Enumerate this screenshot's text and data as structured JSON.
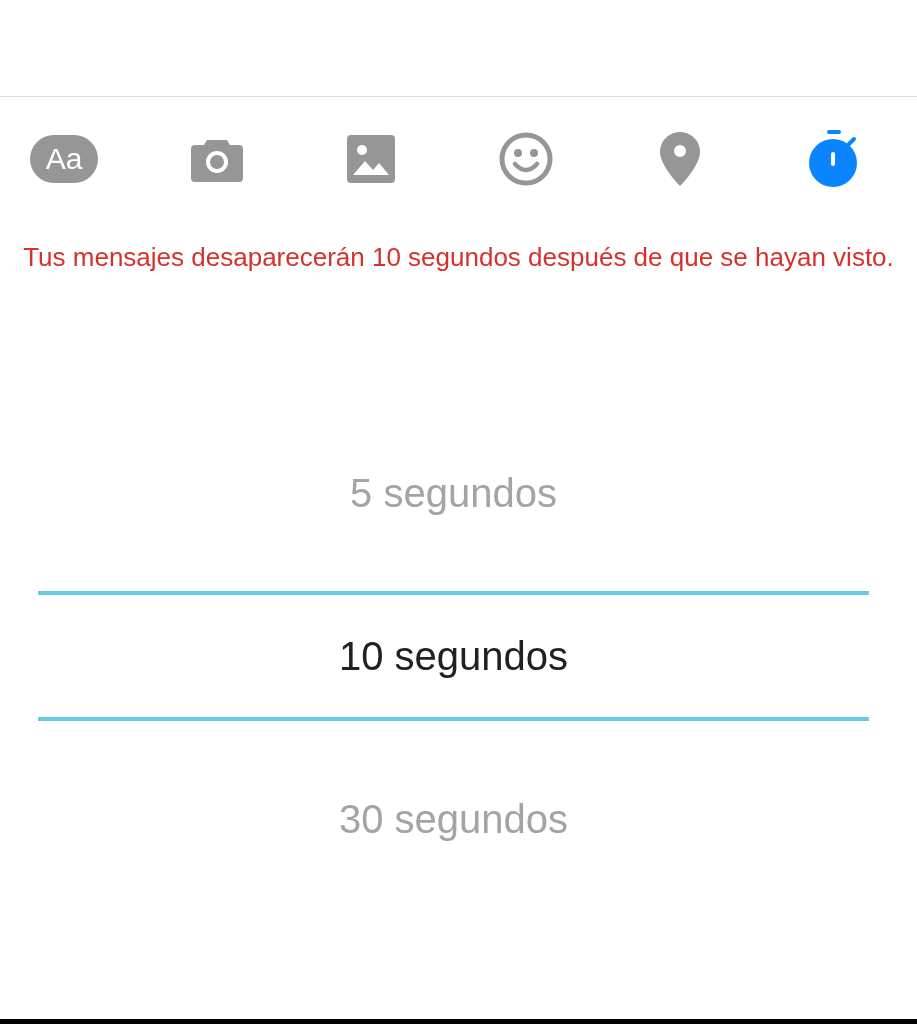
{
  "toolbar": [
    {
      "kind": "text",
      "label": "Aa",
      "selected": false
    },
    {
      "kind": "camera",
      "selected": false
    },
    {
      "kind": "image",
      "selected": false
    },
    {
      "kind": "emoji",
      "selected": false
    },
    {
      "kind": "location",
      "selected": false
    },
    {
      "kind": "timer",
      "selected": true
    }
  ],
  "notice": "Tus mensajes desaparecerán 10 segundos después de que se hayan visto.",
  "picker": [
    {
      "label": "5 segundos",
      "selected": false
    },
    {
      "label": "10 segundos",
      "selected": true
    },
    {
      "label": "30 segundos",
      "selected": false
    }
  ]
}
